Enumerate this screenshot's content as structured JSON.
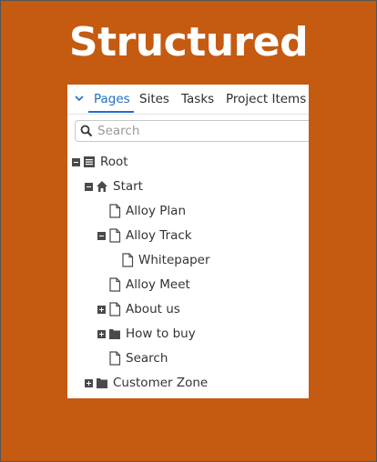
{
  "slide": {
    "title": "Structured"
  },
  "tabs": [
    {
      "label": "Pages",
      "active": true
    },
    {
      "label": "Sites",
      "active": false
    },
    {
      "label": "Tasks",
      "active": false
    },
    {
      "label": "Project Items",
      "active": false
    }
  ],
  "search": {
    "placeholder": "Search",
    "value": ""
  },
  "tree": [
    {
      "label": "Root",
      "icon": "list-icon",
      "toggle": "minus"
    },
    {
      "label": "Start",
      "icon": "home-icon",
      "toggle": "minus"
    },
    {
      "label": "Alloy Plan",
      "icon": "page-icon",
      "toggle": "none"
    },
    {
      "label": "Alloy Track",
      "icon": "page-icon",
      "toggle": "minus"
    },
    {
      "label": "Whitepaper",
      "icon": "page-icon",
      "toggle": "none"
    },
    {
      "label": "Alloy Meet",
      "icon": "page-icon",
      "toggle": "none"
    },
    {
      "label": "About us",
      "icon": "page-icon",
      "toggle": "plus"
    },
    {
      "label": "How to buy",
      "icon": "folder-icon",
      "toggle": "plus"
    },
    {
      "label": "Search",
      "icon": "page-icon",
      "toggle": "none"
    },
    {
      "label": "Customer Zone",
      "icon": "folder-icon",
      "toggle": "plus"
    }
  ],
  "colors": {
    "background": "#c55a11",
    "accent": "#1f6fc5"
  }
}
